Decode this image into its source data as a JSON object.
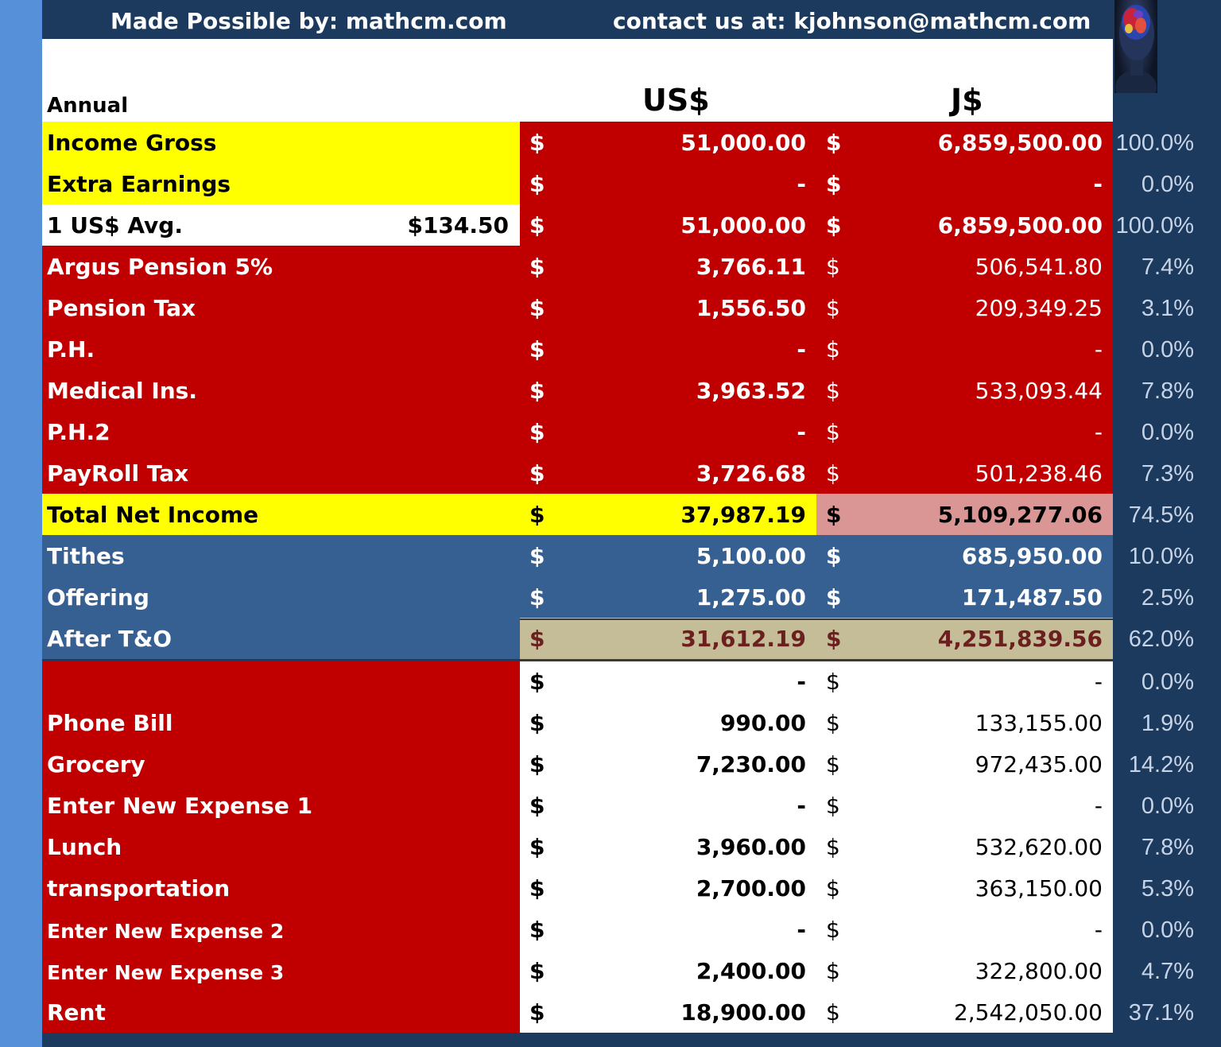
{
  "header": {
    "left_text": "Made Possible by: mathcm.com",
    "right_text": "contact us at: kjohnson@mathcm.com"
  },
  "table": {
    "period_label": "Annual",
    "col_us": "US$",
    "col_j": "J$",
    "currency_symbol": "$",
    "rows": [
      {
        "label": "Income Gross",
        "us": "51,000.00",
        "j": "6,859,500.00",
        "pct": "100.0%"
      },
      {
        "label": "Extra Earnings",
        "us": "-",
        "j": "-",
        "pct": "0.0%"
      },
      {
        "label": "1 US$ Avg.",
        "extra": "$134.50",
        "us": "51,000.00",
        "j": "6,859,500.00",
        "pct": "100.0%"
      },
      {
        "label": "Argus Pension 5%",
        "us": "3,766.11",
        "j": "506,541.80",
        "pct": "7.4%"
      },
      {
        "label": "Pension Tax",
        "us": "1,556.50",
        "j": "209,349.25",
        "pct": "3.1%"
      },
      {
        "label": "P.H.",
        "us": "-",
        "j": "-",
        "pct": "0.0%"
      },
      {
        "label": "Medical Ins.",
        "us": "3,963.52",
        "j": "533,093.44",
        "pct": "7.8%"
      },
      {
        "label": "P.H.2",
        "us": "-",
        "j": "-",
        "pct": "0.0%"
      },
      {
        "label": "PayRoll Tax",
        "us": "3,726.68",
        "j": "501,238.46",
        "pct": "7.3%"
      },
      {
        "label": "Total Net Income",
        "us": "37,987.19",
        "j": "5,109,277.06",
        "pct": "74.5%"
      },
      {
        "label": "Tithes",
        "us": "5,100.00",
        "j": "685,950.00",
        "pct": "10.0%"
      },
      {
        "label": "Offering",
        "us": "1,275.00",
        "j": "171,487.50",
        "pct": "2.5%"
      },
      {
        "label": "After T&O",
        "us": "31,612.19",
        "j": "4,251,839.56",
        "pct": "62.0%"
      },
      {
        "label": "",
        "us": "-",
        "j": "-",
        "pct": "0.0%"
      },
      {
        "label": "Phone Bill",
        "us": "990.00",
        "j": "133,155.00",
        "pct": "1.9%"
      },
      {
        "label": "Grocery",
        "us": "7,230.00",
        "j": "972,435.00",
        "pct": "14.2%"
      },
      {
        "label": "Enter New Expense 1",
        "us": "-",
        "j": "-",
        "pct": "0.0%"
      },
      {
        "label": "Lunch",
        "us": "3,960.00",
        "j": "532,620.00",
        "pct": "7.8%"
      },
      {
        "label": "transportation",
        "us": "2,700.00",
        "j": "363,150.00",
        "pct": "5.3%"
      },
      {
        "label": "Enter New Expense 2",
        "us": "-",
        "j": "-",
        "pct": "0.0%"
      },
      {
        "label": "Enter New Expense 3",
        "us": "2,400.00",
        "j": "322,800.00",
        "pct": "4.7%"
      },
      {
        "label": "Rent",
        "us": "18,900.00",
        "j": "2,542,050.00",
        "pct": "37.1%"
      }
    ]
  },
  "colors": {
    "header_bg": "#1c3a5e",
    "left_strip": "#5590d9",
    "red_fill": "#c00000",
    "yellow_fill": "#ffff00",
    "pink_fill": "#da9694",
    "blue_fill": "#366092",
    "tan_fill": "#c4bd97",
    "tan_text": "#6b1f1f",
    "pct_text": "#c7d3e6"
  },
  "icons": {
    "logo": "brain-head-icon"
  }
}
